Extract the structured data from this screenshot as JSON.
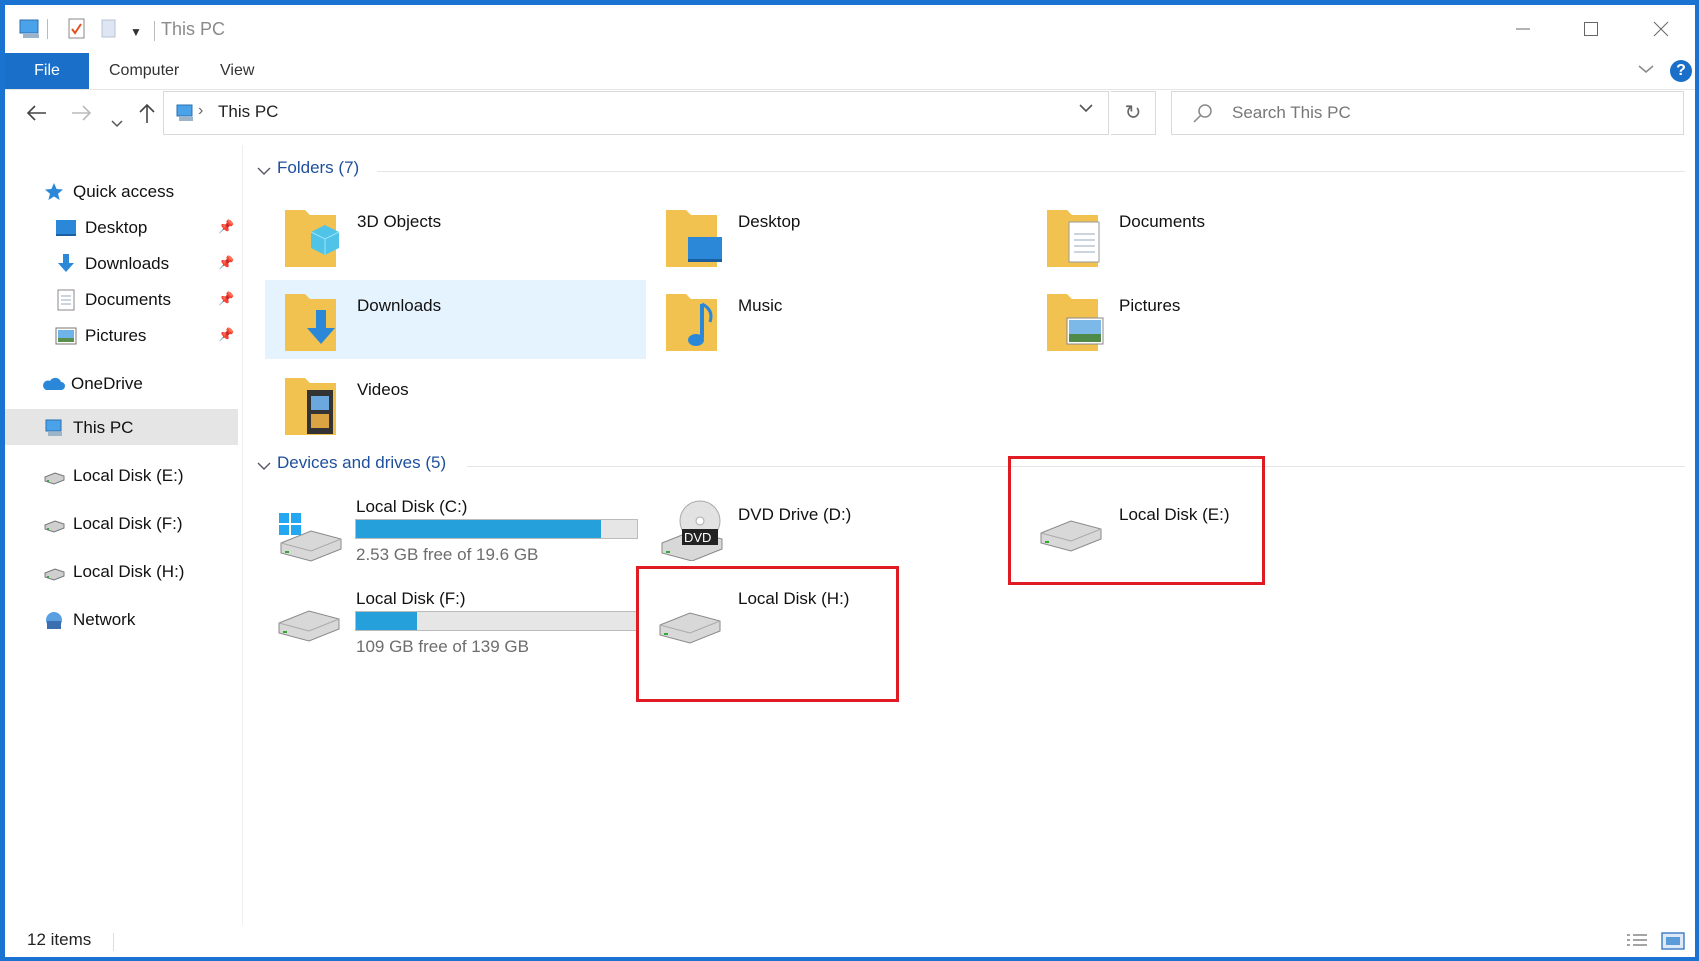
{
  "window": {
    "title": "This PC"
  },
  "ribbon": {
    "tabs": [
      "File",
      "Computer",
      "View"
    ],
    "help": "?"
  },
  "address": {
    "path": "This PC",
    "search_placeholder": "Search This PC"
  },
  "sidebar": {
    "items": [
      {
        "label": "Quick access",
        "icon": "star-icon"
      },
      {
        "label": "Desktop",
        "icon": "desktop-icon",
        "pinned": true
      },
      {
        "label": "Downloads",
        "icon": "download-icon",
        "pinned": true
      },
      {
        "label": "Documents",
        "icon": "documents-icon",
        "pinned": true
      },
      {
        "label": "Pictures",
        "icon": "pictures-icon",
        "pinned": true
      },
      {
        "label": "OneDrive",
        "icon": "cloud-icon"
      },
      {
        "label": "This PC",
        "icon": "computer-icon",
        "selected": true
      },
      {
        "label": "Local Disk (E:)",
        "icon": "drive-icon"
      },
      {
        "label": "Local Disk (F:)",
        "icon": "drive-icon"
      },
      {
        "label": "Local Disk (H:)",
        "icon": "drive-icon"
      },
      {
        "label": "Network",
        "icon": "network-icon"
      }
    ]
  },
  "folders": {
    "header": "Folders (7)",
    "items": [
      {
        "label": "3D Objects",
        "icon": "3d-objects-folder-icon"
      },
      {
        "label": "Desktop",
        "icon": "desktop-folder-icon"
      },
      {
        "label": "Documents",
        "icon": "documents-folder-icon"
      },
      {
        "label": "Downloads",
        "icon": "downloads-folder-icon",
        "selected": true
      },
      {
        "label": "Music",
        "icon": "music-folder-icon"
      },
      {
        "label": "Pictures",
        "icon": "pictures-folder-icon"
      },
      {
        "label": "Videos",
        "icon": "videos-folder-icon"
      }
    ]
  },
  "drives": {
    "header": "Devices and drives (5)",
    "items": [
      {
        "label": "Local Disk (C:)",
        "free_text": "2.53 GB free of 19.6 GB",
        "used_fraction": 0.871,
        "icon": "windows-drive-icon"
      },
      {
        "label": "DVD Drive (D:)",
        "icon": "dvd-drive-icon",
        "badge": "DVD"
      },
      {
        "label": "Local Disk (E:)",
        "icon": "drive-icon",
        "highlighted": true
      },
      {
        "label": "Local Disk (F:)",
        "free_text": "109 GB free of 139 GB",
        "used_fraction": 0.216,
        "icon": "drive-icon"
      },
      {
        "label": "Local Disk (H:)",
        "icon": "drive-icon",
        "highlighted": true
      }
    ]
  },
  "status": {
    "items": "12 items"
  },
  "colors": {
    "accent": "#1a6fc9",
    "highlight_box": "#e01b24",
    "selection": "#e5f3ff",
    "bar_fill": "#26a0da"
  }
}
